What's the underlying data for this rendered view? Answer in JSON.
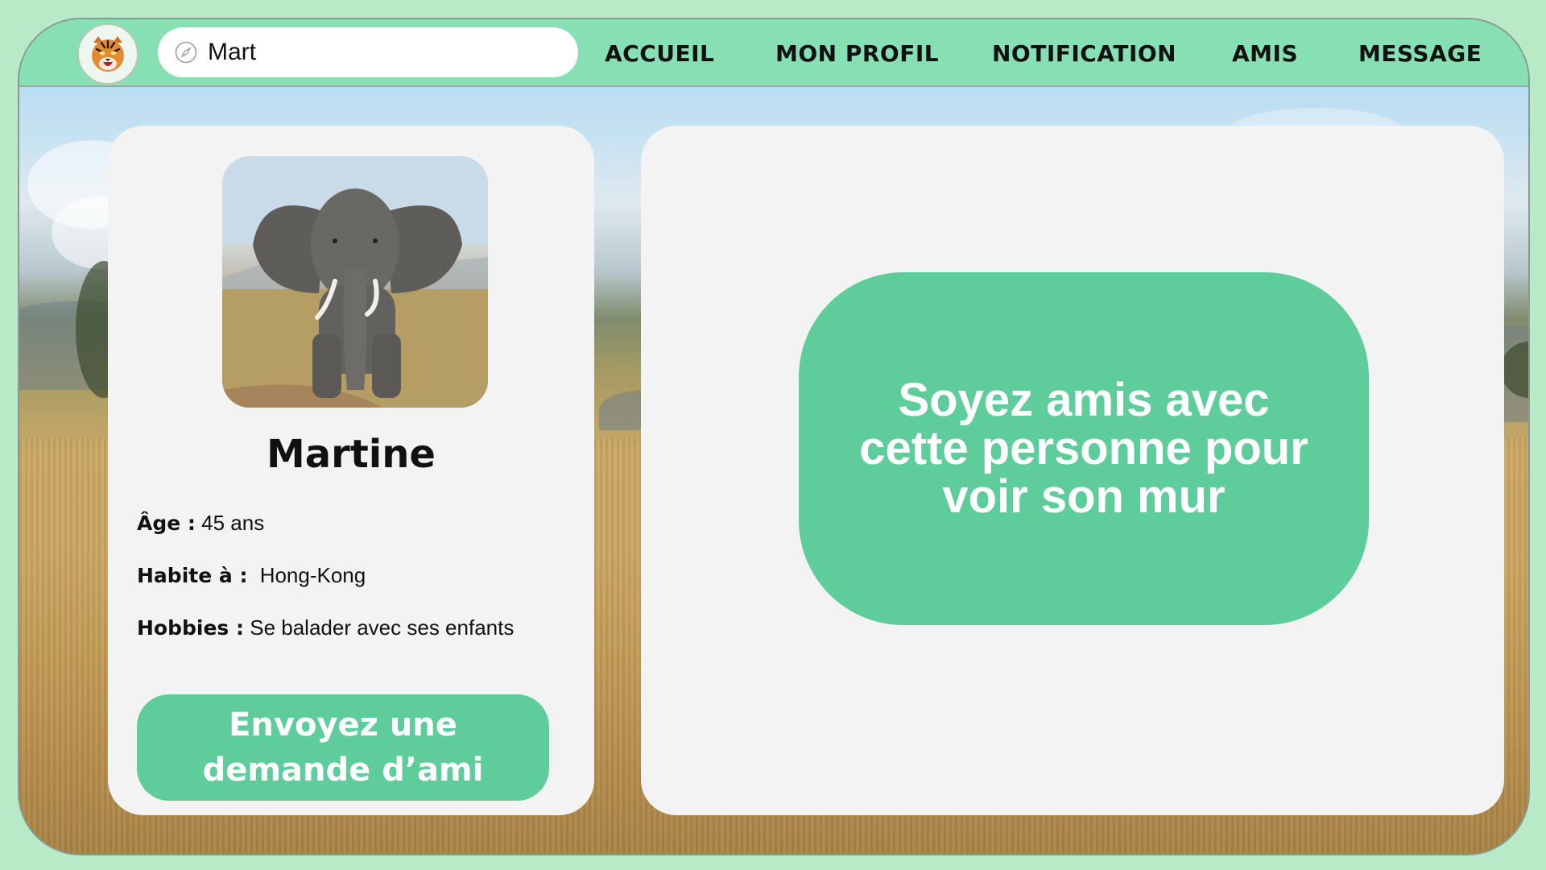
{
  "nav": {
    "search_value": "Mart",
    "items": [
      "ACCUEIL",
      "MON PROFIL",
      "NOTIFICATION",
      "AMIS",
      "MESSAGE"
    ]
  },
  "profile": {
    "name": "Martine",
    "age_label": "Âge :",
    "age_value": "45 ans",
    "city_label": "Habite à :",
    "city_value": "Hong-Kong",
    "hobbies_label": "Hobbies :",
    "hobbies_value": "Se balader avec ses enfants",
    "friend_button": "Envoyez une demande d’ami"
  },
  "wall": {
    "message": "Soyez amis avec cette personne pour voir son mur"
  },
  "colors": {
    "nav_bar": "#86e0b4",
    "accent_green": "#5ecd9b",
    "card_bg": "#f3f3f3",
    "page_bg": "#b9eac7"
  },
  "icons": [
    "tiger-logo-icon",
    "compass-search-icon"
  ]
}
